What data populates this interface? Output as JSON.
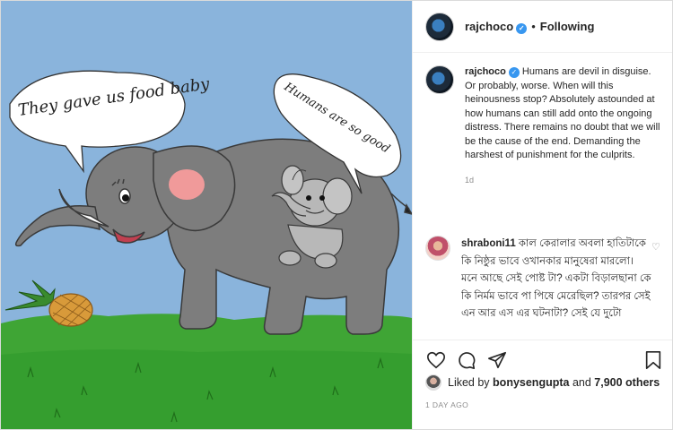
{
  "post": {
    "image": {
      "left_bubble": "They gave us food baby",
      "right_bubble": "Humans are so good"
    },
    "header": {
      "username": "rajchoco",
      "separator": "•",
      "follow_state": "Following"
    },
    "caption": {
      "username": "rajchoco",
      "text": "Humans are devil in disguise. Or probably, worse. When will this heinousness stop? Absolutely astounded at how humans can still add onto the ongoing distress. There remains no doubt that we will be the cause of the end. Demanding the harshest of punishment for the culprits.",
      "time": "1d"
    },
    "comment": {
      "username": "shraboni11",
      "text": "কাল কেরালার অবলা হাতিটাকে কি নিষ্ঠুর ভাবে ওখানকার মানুষেরা মারলো। মনে আছে সেই পোষ্ট টা? একটা বিড়ালছানা কে কি নির্মম ভাবে পা পিষে মেরেছিল? তারপর সেই এন আর এস এর ঘটনাটা? সেই যে দুটো"
    },
    "likes": {
      "prefix": "Liked by",
      "user": "bonysengupta",
      "and": "and",
      "count": "7,900 others"
    },
    "posted": "1 DAY AGO"
  },
  "icons": {
    "like": "heart-icon",
    "comment": "comment-icon",
    "share": "share-icon",
    "save": "bookmark-icon",
    "verified": "verified-badge-icon",
    "comment_like": "small-heart-icon"
  },
  "colors": {
    "sky": "#8ab4dc",
    "grass": "#3fa535",
    "elephant": "#7d7d7d",
    "verified": "#3897f0"
  }
}
